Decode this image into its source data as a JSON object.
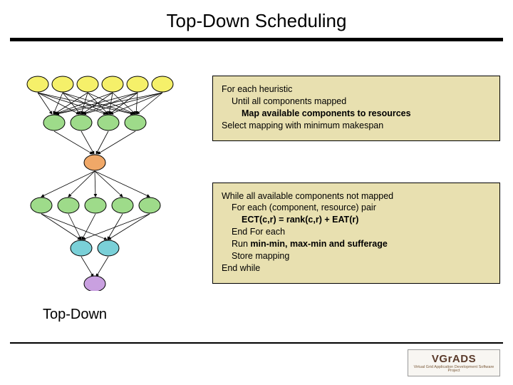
{
  "title": "Top-Down Scheduling",
  "box1": {
    "l1": "For each heuristic",
    "l2": "Until all components mapped",
    "l3": "Map available components to resources",
    "l4": "Select mapping with minimum makespan"
  },
  "box2": {
    "l1": "While all available components not mapped",
    "l2": "For each (component, resource) pair",
    "l3": "ECT(c,r) = rank(c,r) + EAT(r)",
    "l4": "End For each",
    "l5_a": "Run ",
    "l5_b": "min-min, max-min and sufferage",
    "l6": "Store mapping",
    "l7": "End while"
  },
  "caption": "Top-Down",
  "logo": {
    "main": "VGrADS",
    "sub": "Virtual Grid Application Development Software Project"
  },
  "colors": {
    "yellow": "#f5f06a",
    "green": "#9edb8a",
    "orange": "#f0a868",
    "blue": "#7ad0d8",
    "violet": "#c9a0e0"
  }
}
